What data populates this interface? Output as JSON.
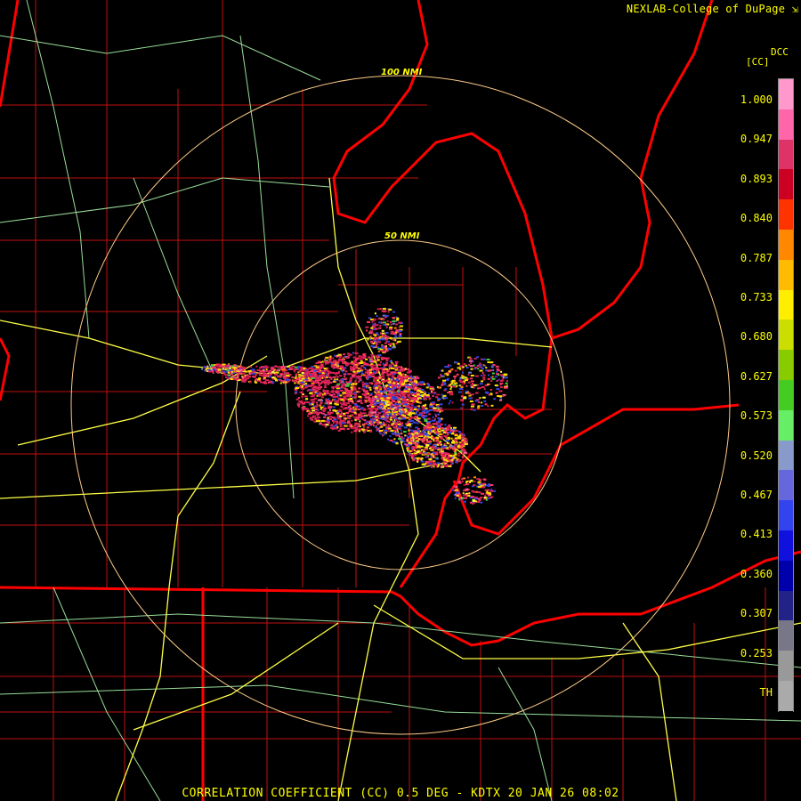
{
  "credit": "NEXLAB-College of DuPage",
  "footer": "CORRELATION COEFFICIENT (CC) 0.5 DEG - KDTX 20 JAN 26 08:02",
  "legend": {
    "code": "DCC",
    "unit": "[CC]",
    "ticks": [
      "1.000",
      "0.947",
      "0.893",
      "0.840",
      "0.787",
      "0.733",
      "0.680",
      "0.627",
      "0.573",
      "0.520",
      "0.467",
      "0.413",
      "0.360",
      "0.307",
      "0.253",
      "TH"
    ],
    "colors": [
      "#ff99cc",
      "#ff66aa",
      "#dd3366",
      "#cc0022",
      "#ff3300",
      "#ff8800",
      "#ffbb00",
      "#ffee00",
      "#ccdd00",
      "#88cc00",
      "#44cc22",
      "#66ee66",
      "#8899cc",
      "#6666dd",
      "#3344ee",
      "#1111dd",
      "#0000aa",
      "#222288",
      "#777788",
      "#999999",
      "#aaaaaa"
    ]
  },
  "range_rings": [
    "100 NMI",
    "50 NMI"
  ],
  "map_colors": {
    "state_border": "#ff0000",
    "county_border": "#cc1111",
    "interstate": "#ffff44",
    "highway": "#99dd99",
    "range_ring": "#ffcc88"
  }
}
